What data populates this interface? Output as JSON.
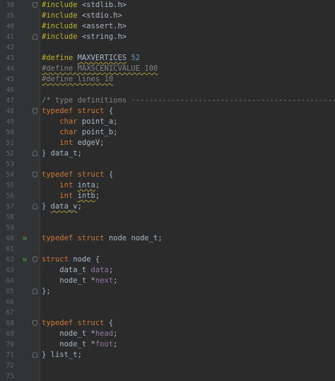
{
  "colors": {
    "background": "#2b2b2b",
    "gutter": "#313335",
    "line_number": "#606366",
    "preprocessor": "#bbb529",
    "keyword": "#cc7832",
    "text": "#a9b7c6",
    "number": "#6897bb",
    "comment": "#808080",
    "field": "#9876aa",
    "override_marker": "#4e9a4e"
  },
  "lines": [
    {
      "num": "38",
      "fold": "open",
      "tokens": [
        {
          "t": "#include",
          "c": "pre"
        },
        {
          "t": " <stdlib.h>",
          "c": "tx"
        }
      ]
    },
    {
      "num": "39",
      "fold": "none",
      "tokens": [
        {
          "t": "#include",
          "c": "pre"
        },
        {
          "t": " <stdio.h>",
          "c": "tx"
        }
      ]
    },
    {
      "num": "40",
      "fold": "none",
      "tokens": [
        {
          "t": "#include",
          "c": "pre"
        },
        {
          "t": " <assert.h>",
          "c": "tx"
        }
      ]
    },
    {
      "num": "41",
      "fold": "close",
      "tokens": [
        {
          "t": "#include",
          "c": "pre"
        },
        {
          "t": " <string.h>",
          "c": "tx"
        }
      ]
    },
    {
      "num": "42",
      "fold": "none",
      "tokens": []
    },
    {
      "num": "43",
      "fold": "none",
      "tokens": [
        {
          "t": "#define",
          "c": "pre"
        },
        {
          "t": " ",
          "c": "tx"
        },
        {
          "t": "MAXVERTICES",
          "c": "tx",
          "squig": true
        },
        {
          "t": " ",
          "c": "tx"
        },
        {
          "t": "52",
          "c": "num"
        }
      ]
    },
    {
      "num": "44",
      "fold": "none",
      "tokens": [
        {
          "t": "#define MAXSCENICVALUE 100",
          "c": "cm",
          "squig": true
        }
      ]
    },
    {
      "num": "45",
      "fold": "none",
      "tokens": [
        {
          "t": "#define lines 10",
          "c": "cm",
          "squig": true
        }
      ]
    },
    {
      "num": "46",
      "fold": "none",
      "tokens": []
    },
    {
      "num": "47",
      "fold": "none",
      "tokens": [
        {
          "t": "/* type definitions -------------------------------------------------------",
          "c": "cm"
        }
      ]
    },
    {
      "num": "48",
      "fold": "open",
      "tokens": [
        {
          "t": "typedef struct",
          "c": "kw"
        },
        {
          "t": " {",
          "c": "tx"
        }
      ]
    },
    {
      "num": "49",
      "fold": "none",
      "tokens": [
        {
          "t": "    ",
          "c": "tx"
        },
        {
          "t": "char",
          "c": "kw"
        },
        {
          "t": " point_a;",
          "c": "tx"
        }
      ]
    },
    {
      "num": "50",
      "fold": "none",
      "tokens": [
        {
          "t": "    ",
          "c": "tx"
        },
        {
          "t": "char",
          "c": "kw"
        },
        {
          "t": " point_b;",
          "c": "tx"
        }
      ]
    },
    {
      "num": "51",
      "fold": "none",
      "tokens": [
        {
          "t": "    ",
          "c": "tx"
        },
        {
          "t": "int",
          "c": "kw"
        },
        {
          "t": " edgeV;",
          "c": "tx"
        }
      ]
    },
    {
      "num": "52",
      "fold": "close",
      "tokens": [
        {
          "t": "} data_t;",
          "c": "tx"
        }
      ]
    },
    {
      "num": "53",
      "fold": "none",
      "tokens": []
    },
    {
      "num": "54",
      "fold": "open",
      "tokens": [
        {
          "t": "typedef struct",
          "c": "kw"
        },
        {
          "t": " {",
          "c": "tx"
        }
      ]
    },
    {
      "num": "55",
      "fold": "none",
      "tokens": [
        {
          "t": "    ",
          "c": "tx"
        },
        {
          "t": "int",
          "c": "kw"
        },
        {
          "t": " ",
          "c": "tx"
        },
        {
          "t": "inta",
          "c": "tx",
          "squig": true
        },
        {
          "t": ";",
          "c": "tx"
        }
      ]
    },
    {
      "num": "56",
      "fold": "none",
      "tokens": [
        {
          "t": "    ",
          "c": "tx"
        },
        {
          "t": "int",
          "c": "kw"
        },
        {
          "t": " ",
          "c": "tx"
        },
        {
          "t": "intb",
          "c": "tx",
          "squig": true
        },
        {
          "t": ";",
          "c": "tx"
        }
      ]
    },
    {
      "num": "57",
      "fold": "close",
      "tokens": [
        {
          "t": "} ",
          "c": "tx"
        },
        {
          "t": "data_v",
          "c": "tx",
          "squig": true
        },
        {
          "t": ";",
          "c": "tx"
        }
      ]
    },
    {
      "num": "58",
      "fold": "none",
      "tokens": []
    },
    {
      "num": "59",
      "fold": "none",
      "tokens": []
    },
    {
      "num": "60",
      "fold": "none",
      "marker": "⇆",
      "tokens": [
        {
          "t": "typedef struct",
          "c": "kw"
        },
        {
          "t": " node node_t;",
          "c": "tx"
        }
      ]
    },
    {
      "num": "61",
      "fold": "none",
      "tokens": []
    },
    {
      "num": "62",
      "fold": "open",
      "marker": "⇆",
      "tokens": [
        {
          "t": "struct",
          "c": "kw"
        },
        {
          "t": " node {",
          "c": "tx"
        }
      ]
    },
    {
      "num": "63",
      "fold": "none",
      "tokens": [
        {
          "t": "    data_t ",
          "c": "tx"
        },
        {
          "t": "data",
          "c": "fld"
        },
        {
          "t": ";",
          "c": "tx"
        }
      ]
    },
    {
      "num": "64",
      "fold": "none",
      "tokens": [
        {
          "t": "    node_t *",
          "c": "tx"
        },
        {
          "t": "next",
          "c": "fld"
        },
        {
          "t": ";",
          "c": "tx"
        }
      ]
    },
    {
      "num": "65",
      "fold": "close",
      "tokens": [
        {
          "t": "};",
          "c": "tx"
        }
      ]
    },
    {
      "num": "66",
      "fold": "none",
      "tokens": []
    },
    {
      "num": "67",
      "fold": "none",
      "tokens": []
    },
    {
      "num": "68",
      "fold": "open",
      "tokens": [
        {
          "t": "typedef struct",
          "c": "kw"
        },
        {
          "t": " {",
          "c": "tx"
        }
      ]
    },
    {
      "num": "69",
      "fold": "none",
      "tokens": [
        {
          "t": "    node_t *",
          "c": "tx"
        },
        {
          "t": "head",
          "c": "fld"
        },
        {
          "t": ";",
          "c": "tx"
        }
      ]
    },
    {
      "num": "70",
      "fold": "none",
      "tokens": [
        {
          "t": "    node_t *",
          "c": "tx"
        },
        {
          "t": "foot",
          "c": "fld"
        },
        {
          "t": ";",
          "c": "tx"
        }
      ]
    },
    {
      "num": "71",
      "fold": "close",
      "tokens": [
        {
          "t": "} list_t;",
          "c": "tx"
        }
      ]
    },
    {
      "num": "72",
      "fold": "none",
      "tokens": []
    },
    {
      "num": "73",
      "fold": "none",
      "tokens": []
    }
  ]
}
